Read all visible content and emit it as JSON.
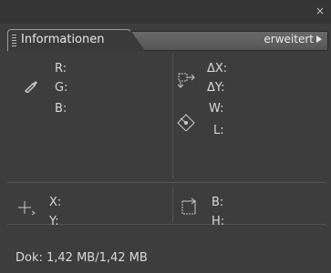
{
  "window": {
    "close_glyph": "×"
  },
  "tab": {
    "title": "Informationen"
  },
  "menu": {
    "label": "erweitert"
  },
  "color_section": {
    "r": "R:",
    "g": "G:",
    "b": "B:",
    "icon": "eyedropper-icon"
  },
  "delta_section": {
    "dx": "ΔX:",
    "dy": "ΔY:",
    "w": "W:",
    "l": "L:",
    "icon1": "move-offset-icon",
    "icon2": "rotate-diamond-icon"
  },
  "position_section": {
    "x": "X:",
    "y": "Y:",
    "icon": "crosshair-icon"
  },
  "size_section": {
    "b": "B:",
    "h": "H:",
    "icon": "size-icon"
  },
  "status": {
    "doc": "Dok: 1,42 MB/1,42 MB"
  }
}
